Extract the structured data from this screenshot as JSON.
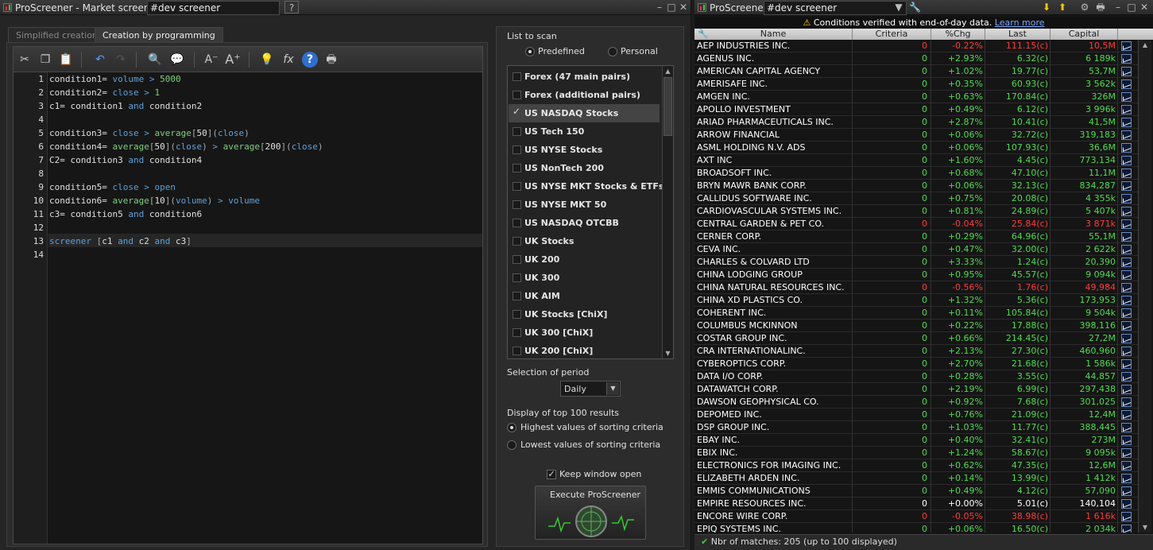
{
  "left_window": {
    "title": "ProScreener - Market screening -",
    "screener_name": "#dev screener",
    "tabs": [
      "Simplified creation",
      "Creation by programming"
    ],
    "active_tab": 1,
    "code_lines": [
      "condition1= volume > 5000",
      "condition2= close > 1",
      "c1= condition1 and condition2",
      "",
      "condition3= close > average[50](close)",
      "condition4= average[50](close) > average[200](close)",
      "C2= condition3 and condition4",
      "",
      "condition5= close > open",
      "condition6= average[10](volume) > volume",
      "c3= condition5 and condition6",
      "",
      "screener [c1 and c2 and c3]",
      ""
    ],
    "line_numbers": [
      "1",
      "2",
      "3",
      "4",
      "5",
      "6",
      "7",
      "8",
      "9",
      "10",
      "11",
      "12",
      "13",
      "14"
    ]
  },
  "scan": {
    "title": "List to scan",
    "predefined": "Predefined",
    "personal": "Personal",
    "selected_mode": "predefined",
    "items": [
      "Forex (47 main pairs)",
      "Forex (additional pairs)",
      "US NASDAQ Stocks",
      "US Tech 150",
      "US NYSE Stocks",
      "US NonTech 200",
      "US NYSE MKT Stocks & ETFs",
      "US NYSE MKT 50",
      "US NASDAQ OTCBB",
      "UK Stocks",
      "UK 200",
      "UK 300",
      "UK AIM",
      "UK Stocks [ChiX]",
      "UK 300 [ChiX]",
      "UK 200 [ChiX]"
    ],
    "selected_index": 2
  },
  "period": {
    "label": "Selection of period",
    "value": "Daily"
  },
  "display": {
    "label": "Display of top 100 results",
    "highest": "Highest values of sorting criteria",
    "lowest": "Lowest values of sorting criteria"
  },
  "keep_open": "Keep window open",
  "execute": "Execute ProScreener",
  "right_window": {
    "title": "ProScreener",
    "screener_name": "#dev screener",
    "banner": "Conditions verified with end-of-day data.",
    "banner_link": "Learn more",
    "headers": [
      "Name",
      "Criteria",
      "%Chg",
      "Last",
      "Capital"
    ],
    "footer": "Nbr of matches: 205 (up to 100 displayed)"
  },
  "results": [
    [
      "AEP INDUSTRIES INC.",
      "0",
      "-0.22%",
      "111.15(c)",
      "10,5M"
    ],
    [
      "AGENUS INC.",
      "0",
      "+2.93%",
      "6.32(c)",
      "6 189k"
    ],
    [
      "AMERICAN CAPITAL AGENCY",
      "0",
      "+1.02%",
      "19.77(c)",
      "53,7M"
    ],
    [
      "AMERISAFE INC.",
      "0",
      "+0.35%",
      "60.93(c)",
      "3 562k"
    ],
    [
      "AMGEN INC.",
      "0",
      "+0.63%",
      "170.84(c)",
      "326M"
    ],
    [
      "APOLLO INVESTMENT",
      "0",
      "+0.49%",
      "6.12(c)",
      "3 996k"
    ],
    [
      "ARIAD PHARMACEUTICALS INC.",
      "0",
      "+2.87%",
      "10.41(c)",
      "41,5M"
    ],
    [
      "ARROW FINANCIAL",
      "0",
      "+0.06%",
      "32.72(c)",
      "319,183"
    ],
    [
      "ASML HOLDING N.V. ADS",
      "0",
      "+0.06%",
      "107.93(c)",
      "36,6M"
    ],
    [
      "AXT INC",
      "0",
      "+1.60%",
      "4.45(c)",
      "773,134"
    ],
    [
      "BROADSOFT INC.",
      "0",
      "+0.68%",
      "47.10(c)",
      "11,1M"
    ],
    [
      "BRYN MAWR BANK CORP.",
      "0",
      "+0.06%",
      "32.13(c)",
      "834,287"
    ],
    [
      "CALLIDUS SOFTWARE INC.",
      "0",
      "+0.75%",
      "20.08(c)",
      "4 355k"
    ],
    [
      "CARDIOVASCULAR SYSTEMS INC.",
      "0",
      "+0.81%",
      "24.89(c)",
      "5 407k"
    ],
    [
      "CENTRAL GARDEN & PET CO.",
      "0",
      "-0.04%",
      "25.84(c)",
      "3 871k"
    ],
    [
      "CERNER CORP.",
      "0",
      "+0.29%",
      "64.96(c)",
      "55,1M"
    ],
    [
      "CEVA INC.",
      "0",
      "+0.47%",
      "32.00(c)",
      "2 622k"
    ],
    [
      "CHARLES & COLVARD LTD",
      "0",
      "+3.33%",
      "1.24(c)",
      "20,390"
    ],
    [
      "CHINA LODGING GROUP",
      "0",
      "+0.95%",
      "45.57(c)",
      "9 094k"
    ],
    [
      "CHINA NATURAL RESOURCES INC.",
      "0",
      "-0.56%",
      "1.76(c)",
      "49,984"
    ],
    [
      "CHINA XD PLASTICS CO.",
      "0",
      "+1.32%",
      "5.36(c)",
      "173,953"
    ],
    [
      "COHERENT INC.",
      "0",
      "+0.11%",
      "105.84(c)",
      "9 504k"
    ],
    [
      "COLUMBUS MCKINNON",
      "0",
      "+0.22%",
      "17.88(c)",
      "398,116"
    ],
    [
      "COSTAR GROUP INC.",
      "0",
      "+0.66%",
      "214.45(c)",
      "27,2M"
    ],
    [
      "CRA INTERNATIONALINC.",
      "0",
      "+2.13%",
      "27.30(c)",
      "460,960"
    ],
    [
      "CYBEROPTICS CORP.",
      "0",
      "+2.70%",
      "21.68(c)",
      "1 586k"
    ],
    [
      "DATA I/O CORP.",
      "0",
      "+0.28%",
      "3.55(c)",
      "44,857"
    ],
    [
      "DATAWATCH CORP.",
      "0",
      "+2.19%",
      "6.99(c)",
      "297,438"
    ],
    [
      "DAWSON GEOPHYSICAL CO.",
      "0",
      "+0.92%",
      "7.68(c)",
      "301,025"
    ],
    [
      "DEPOMED INC.",
      "0",
      "+0.76%",
      "21.09(c)",
      "12,4M"
    ],
    [
      "DSP GROUP INC.",
      "0",
      "+1.03%",
      "11.77(c)",
      "388,445"
    ],
    [
      "EBAY INC.",
      "0",
      "+0.40%",
      "32.41(c)",
      "273M"
    ],
    [
      "EBIX INC.",
      "0",
      "+1.24%",
      "58.67(c)",
      "9 095k"
    ],
    [
      "ELECTRONICS FOR IMAGING INC.",
      "0",
      "+0.62%",
      "47.35(c)",
      "12,6M"
    ],
    [
      "ELIZABETH ARDEN INC.",
      "0",
      "+0.14%",
      "13.99(c)",
      "1 412k"
    ],
    [
      "EMMIS COMMUNICATIONS",
      "0",
      "+0.49%",
      "4.12(c)",
      "57,090"
    ],
    [
      "EMPIRE RESOURCES INC.",
      "0",
      "+0.00%",
      "5.01(c)",
      "140,104"
    ],
    [
      "ENCORE WIRE CORP.",
      "0",
      "-0.05%",
      "38.98(c)",
      "1 616k"
    ],
    [
      "EPIQ SYSTEMS INC.",
      "0",
      "+0.06%",
      "16.50(c)",
      "2 034k"
    ]
  ]
}
